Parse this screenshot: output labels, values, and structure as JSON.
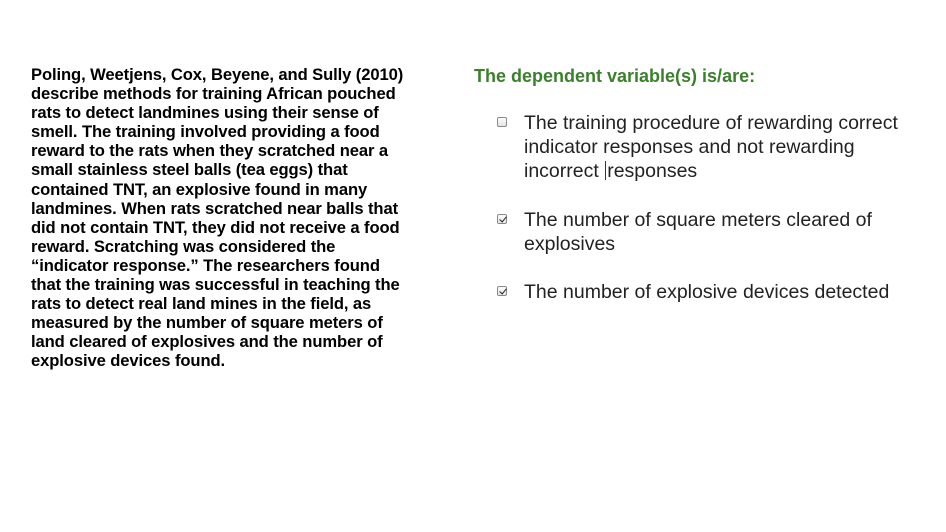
{
  "passage": {
    "text": "Poling, Weetjens, Cox, Beyene, and Sully (2010)\ndescribe methods for training African pouched\nrats to detect landmines using their sense of\nsmell. The training involved providing a food\nreward to the rats when they scratched near a\nsmall stainless steel balls (tea eggs) that\ncontained TNT, an explosive found in many\nlandmines. When rats scratched near balls that\ndid not contain TNT, they did not receive a food\nreward. Scratching was considered the\n“indicator response.” The researchers found\nthat the training was successful in teaching the\nrats to detect real land mines in the field, as\nmeasured by the number of square meters of\nland cleared of explosives and the number of\nexplosive devices found."
  },
  "question": {
    "prompt": "The dependent variable(s) is/are:",
    "color": "#3c7f2e"
  },
  "options": [
    {
      "label_before_cursor": "The training procedure of rewarding correct\nindicator responses and not rewarding\nincorrect ",
      "label_after_cursor": "responses",
      "checked": false
    },
    {
      "label": "The number of square meters cleared of\nexplosives",
      "checked": true
    },
    {
      "label": "The number of explosive devices detected",
      "checked": true
    }
  ]
}
